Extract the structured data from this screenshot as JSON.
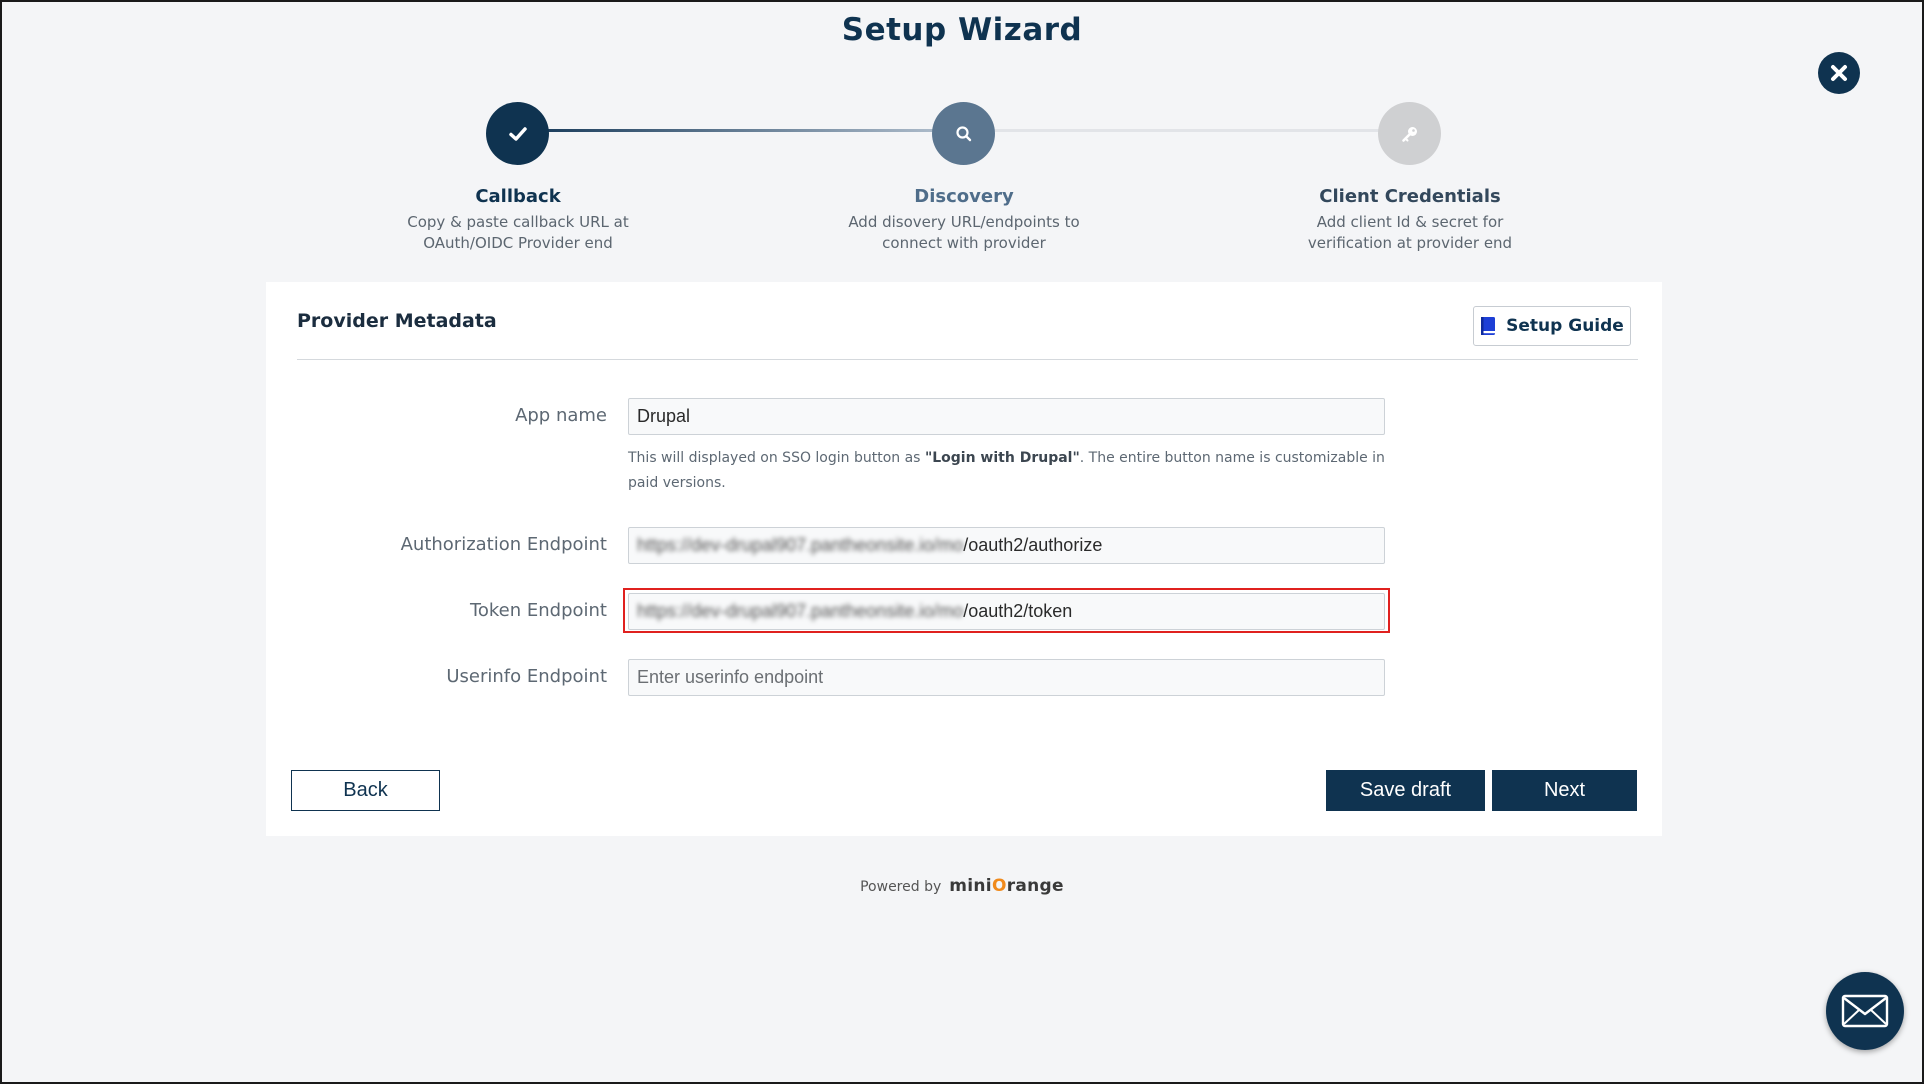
{
  "wizard": {
    "title": "Setup Wizard"
  },
  "steps": [
    {
      "title": "Callback",
      "desc_line1": "Copy & paste callback URL at",
      "desc_line2": "OAuth/OIDC Provider end",
      "state": "done",
      "icon": "check-icon"
    },
    {
      "title": "Discovery",
      "desc_line1": "Add disovery URL/endpoints to",
      "desc_line2": "connect with provider",
      "state": "active",
      "icon": "search-icon"
    },
    {
      "title": "Client Credentials",
      "desc_line1": "Add client Id & secret for",
      "desc_line2": "verification at provider end",
      "state": "pending",
      "icon": "key-icon"
    }
  ],
  "card": {
    "title": "Provider Metadata",
    "setup_guide_label": "Setup Guide",
    "fields": {
      "app_name": {
        "label": "App name",
        "value": "Drupal"
      },
      "help_pre": "This will displayed on SSO login button as ",
      "help_bold": "\"Login with Drupal\"",
      "help_post": ". The entire button name is customizable in paid versions.",
      "auth": {
        "label": "Authorization Endpoint",
        "value_blurred": "https://dev-drupal907.pantheonsite.io/mo",
        "value_suffix": "/oauth2/authorize"
      },
      "token": {
        "label": "Token Endpoint",
        "value_blurred": "https://dev-drupal907.pantheonsite.io/mo",
        "value_suffix": "/oauth2/token"
      },
      "userinfo": {
        "label": "Userinfo Endpoint",
        "placeholder": "Enter userinfo endpoint"
      }
    },
    "buttons": {
      "back": "Back",
      "save_draft": "Save draft",
      "next": "Next"
    }
  },
  "footer": {
    "powered_by": "Powered by",
    "brand_pre": "mini",
    "brand_o": "O",
    "brand_post": "range"
  },
  "colors": {
    "primary": "#0f3350",
    "highlight": "#e0211f",
    "brand_orange": "#f08a1c"
  }
}
